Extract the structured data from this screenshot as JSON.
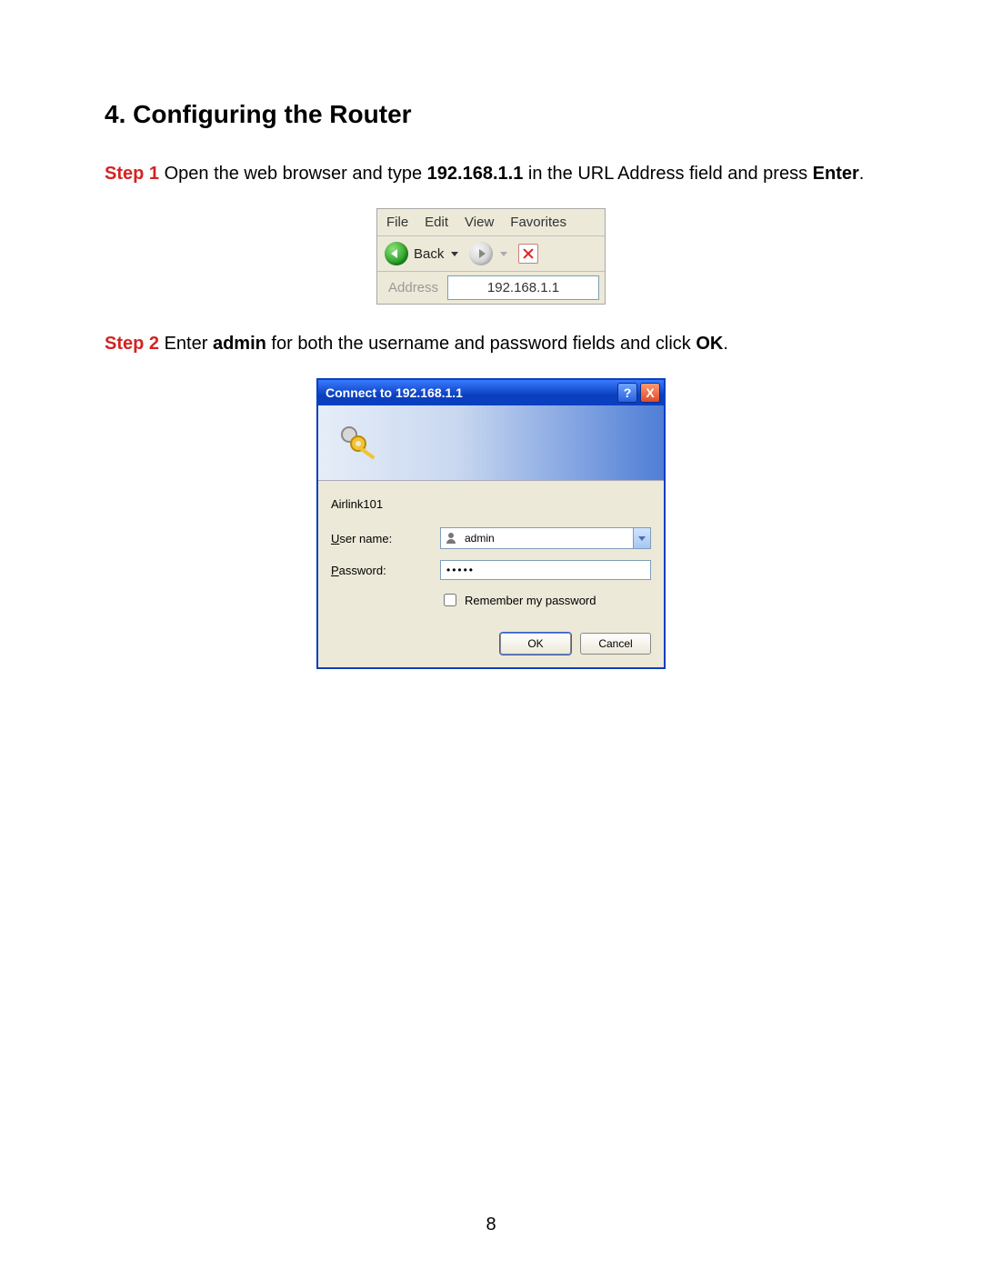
{
  "section_title": "4. Configuring the Router",
  "step1": {
    "label": "Step 1",
    "text_before_ip": " Open the web browser and type ",
    "ip": "192.168.1.1",
    "text_after_ip": " in the URL Address field and press ",
    "enter_word": "Enter",
    "period": "."
  },
  "step2": {
    "label": "Step 2",
    "text_before_admin": " Enter ",
    "admin_word": "admin",
    "text_after_admin": " for both the username and password fields and click ",
    "ok_word": "OK",
    "period": "."
  },
  "browser": {
    "menu": {
      "file": "File",
      "edit": "Edit",
      "view": "View",
      "favorites": "Favorites"
    },
    "back_label": "Back",
    "address_label": "Address",
    "address_value": "192.168.1.1"
  },
  "dialog": {
    "title": "Connect to 192.168.1.1",
    "help_symbol": "?",
    "close_symbol": "X",
    "realm": "Airlink101",
    "username_label_prefix": "U",
    "username_label_rest": "ser name:",
    "password_label_prefix": "P",
    "password_label_rest": "assword:",
    "username_value": "admin",
    "password_value": "•••••",
    "remember_prefix": "R",
    "remember_rest": "emember my password",
    "ok_btn": "OK",
    "cancel_btn": "Cancel"
  },
  "page_number": "8"
}
